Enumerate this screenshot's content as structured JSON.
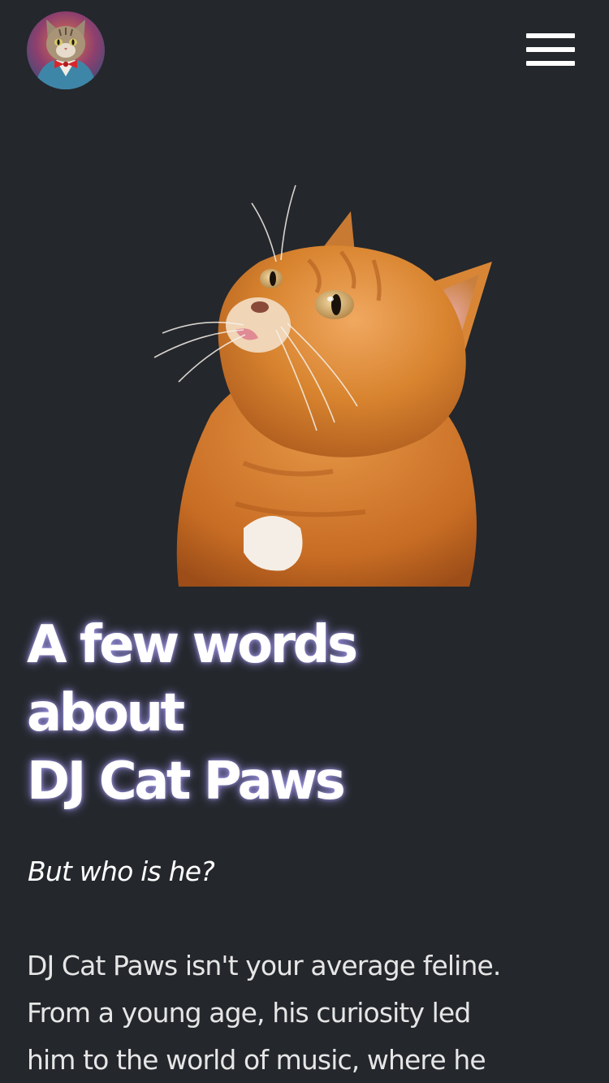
{
  "header": {
    "avatar_icon": "cat-avatar-icon",
    "menu_icon": "hamburger-menu-icon"
  },
  "hero": {
    "image_icon": "orange-cat-photo"
  },
  "about": {
    "title_lines": [
      "A few words",
      "about",
      "DJ Cat Paws"
    ],
    "subtitle": "But who is he?",
    "paragraph_lines": [
      "DJ Cat Paws isn't your average feline.",
      "From a young age, his curiosity led",
      "him to the world of music, where he"
    ]
  },
  "colors": {
    "background": "#24272c",
    "text": "#ffffff",
    "glow": "#aaa0ff",
    "cat_fur": "#d9832f"
  }
}
